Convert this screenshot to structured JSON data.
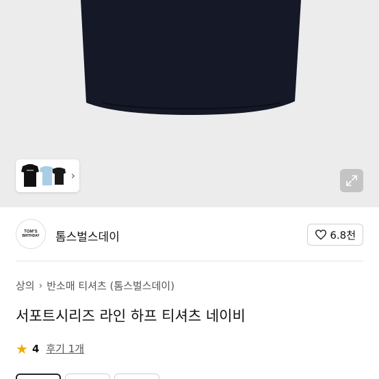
{
  "gallery": {
    "thumbnail_chevron": "›",
    "expand_icon": "expand-icon"
  },
  "seller": {
    "logo_line1": "TOM'S",
    "logo_line2": "BIRTHDAY",
    "name": "톰스벌스데이",
    "like_count": "6.8천"
  },
  "breadcrumb": {
    "items": [
      "상의",
      "반소매 티셔츠 (톰스벌스데이)"
    ],
    "separator": "›"
  },
  "product": {
    "title": "서포트시리즈 라인 하프 티셔츠 네이비"
  },
  "rating": {
    "score": "4",
    "reviews": "후기 1개"
  },
  "colors": {
    "shirt": "#151826",
    "star": "#f2a900",
    "gallery_bg": "#ececec"
  }
}
